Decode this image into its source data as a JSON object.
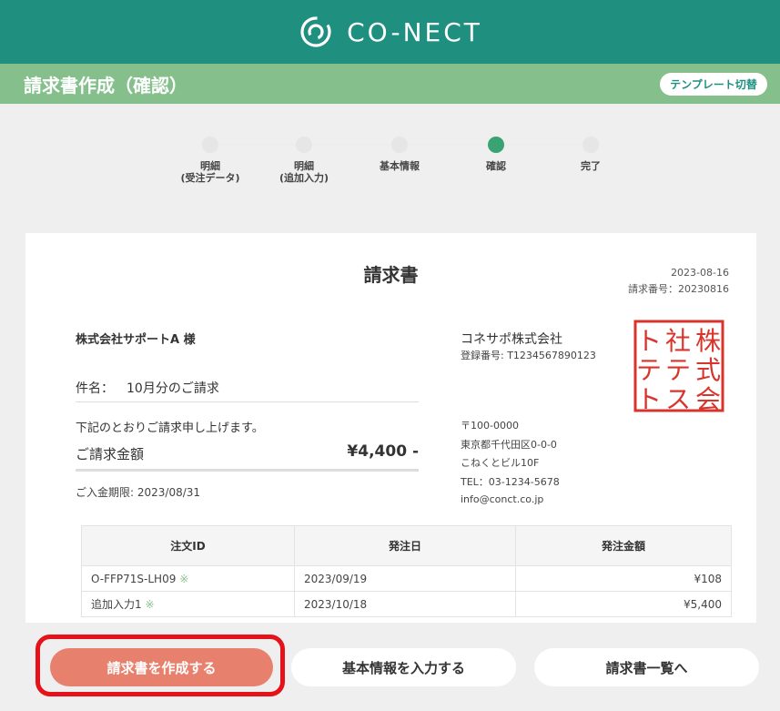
{
  "brand": {
    "name": "CO-NECT"
  },
  "page": {
    "title": "請求書作成（確認）",
    "template_button": "テンプレート切替"
  },
  "steps": [
    {
      "label1": "明細",
      "label2": "(受注データ)",
      "active": false
    },
    {
      "label1": "明細",
      "label2": "(追加入力)",
      "active": false
    },
    {
      "label1": "基本情報",
      "label2": "",
      "active": false
    },
    {
      "label1": "確認",
      "label2": "",
      "active": true
    },
    {
      "label1": "完了",
      "label2": "",
      "active": false
    }
  ],
  "invoice": {
    "title": "請求書",
    "date": "2023-08-16",
    "number": "請求番号：20230816",
    "client": "株式会社サポートA 様",
    "subject_label": "件名：",
    "subject": "10月分のご請求",
    "notice": "下記のとおりご請求申し上げます。",
    "amount_label": "ご請求金額",
    "amount": "¥4,400 -",
    "due": "ご入金期限: 2023/08/31",
    "issuer": {
      "company": "コネサポ株式会社",
      "reg_no": "登録番号: T1234567890123",
      "zip": "〒100-0000",
      "address": "東京都千代田区0-0-0",
      "building": "こねくとビル10F",
      "tel": "TEL：03-1234-5678",
      "email": "info@conct.co.jp"
    },
    "seal_text": "株式会社テストテスト",
    "table": {
      "headers": [
        "注文ID",
        "発注日",
        "発注金額"
      ],
      "rows": [
        {
          "id": "O-FFP71S-LH09",
          "mark": "※",
          "date": "2023/09/19",
          "amount": "¥108"
        },
        {
          "id": "追加入力1",
          "mark": "※",
          "date": "2023/10/18",
          "amount": "¥5,400"
        }
      ]
    }
  },
  "footer": {
    "create": "請求書を作成する",
    "basic_info": "基本情報を入力する",
    "list": "請求書一覧へ"
  },
  "colors": {
    "header": "#1f9080",
    "subheader": "#85c08c",
    "accent": "#e8806e",
    "highlight": "#e5121a"
  }
}
